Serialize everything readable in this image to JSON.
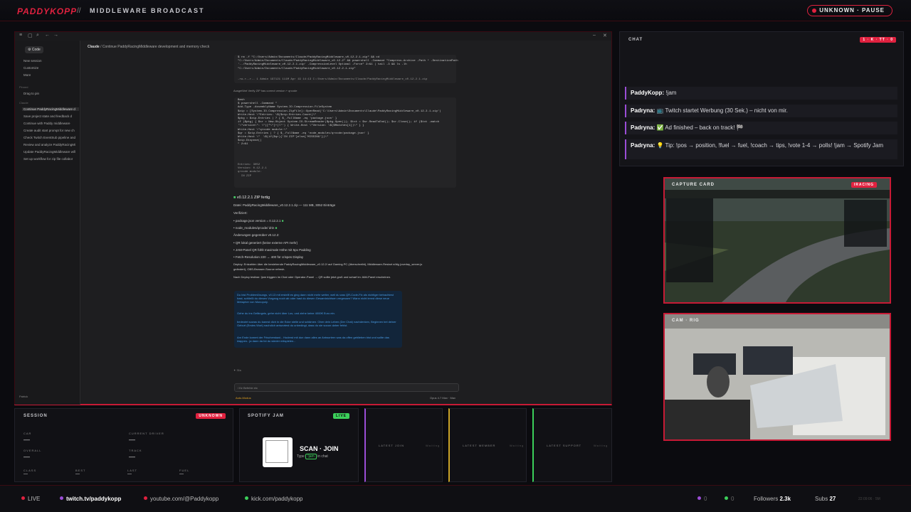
{
  "header": {
    "brand": "PADDYKOPP",
    "separator": "//",
    "title": "MIDDLEWARE BROADCAST",
    "status": "UNKNOWN · PAUSE"
  },
  "desktop": {
    "sidebar": {
      "code_tab": "Code",
      "actions": [
        "New session",
        "Customize",
        "More"
      ],
      "pinned_head": "Pinned",
      "pinned_hint": "Drag to pin",
      "claude_head": "Claude",
      "items": [
        "Continue PaddyRacingMiddleware d",
        "Save project state and feedback d",
        "Continue with Paddy middleware",
        "Create audit start prompt for new ch",
        "Check Twitch EventSub pipeline and",
        "Review and analyze PaddyRacingMi",
        "Update PaddyRacingMiddleware w/ll",
        "Set up workflow for zip file collabor"
      ],
      "user": "Patrick"
    },
    "breadcrumb": {
      "root": "Claude",
      "sep": "/",
      "page": "Continue PaddyRacingMiddleware development and memory check"
    },
    "code_block1": "$ rm -f \"C:/Users/Admin/Documents/Claude/PaddyRacingMiddleware_v0.12.2.1.zip\" && cd\n\"C:/Users/Admin/Documents/Claude/PaddyRacingMiddleware_v0.12.2\" && powershell -Command \"Compress-Archive -Path * -DestinationPath\n'../PaddyRacingMiddleware_v0.12.2.1.zip' -CompressionLevel Optimal -Force\" 2>&1 | tail -3 && ls -lh\n\"C:/Users/Admin/Documents/Claude/PaddyRacingMiddleware_v0.12.2.1.zip\"",
    "code_result1": "-rw-r--r-- 1 Admin 197121 111M Apr 19 14:13 C:/Users/Admin/Documents/Claude/PaddyRacingMiddleware_v0.12.2.1.zip",
    "verify_caption": "Ausgeführt Verify ZIP has correct version + qrcode",
    "code_block2": "Bash\n$ powershell -Command \"\nAdd-Type -AssemblyName System.IO.Compression.FileSystem\n$zip = [System.IO.Compression.ZipFile]::OpenRead('C:\\Users\\Admin\\Documents\\Claude\\PaddyRacingMiddleware_v0.12.2.1.zip')\nWrite-Host \\\"Entries: \\$($zip.Entries.Count)\\\"\n$pkg = $zip.Entries | ? { $_.FullName -eq 'package.json' }\nif ($pkg) { $sr = New-Object System.IO.StreamReader($pkg.Open()); $txt = $sr.ReadToEnd(); $sr.Close(); if ($txt -match\n'\\\"version\\\": \\\"([^\\\"]+)\\\"') { Write-Host \\\"Version: \\$($Matches[1])\\\" } }\nWrite-Host \\\"qrcode module:\\\"\n$qr = $zip.Entries | ? { $_.FullName -eq 'node_modules/qrcode/package.json' }\nWrite-Host \\\"  \\$(if($qr){'IN ZIP'}else{'MISSING'})\\\"\n$zip.Dispose()\n\" 2>&1",
    "code_result2": "Entries: 3052\nVersion: 0.12.2.1\nqrcode module:\n  IN ZIP",
    "heading": "v0.12.2.1 ZIP fertig",
    "file_line": "Datei: PaddyRacingMiddleware_v0.12.2.1.zip — 111 MB, 3052 Einträge",
    "verified": "Verifiziert:",
    "bullets1": [
      "package.json version = 0.12.2.1",
      "node_modules/qrcode/ drin"
    ],
    "changes": "Änderungen gegenüber v0.12.2:",
    "bullets2": [
      "QR lokal generiert (keine externe API mehr)",
      "JAM-Panel QR fühlt maximale Höhe mit 5px Padding",
      "Fetch-Resolution 220 → 400 für crispes Display"
    ],
    "deploy": "Deploy: Entzahlen über die bestehende PaddyRacingMiddleware_v0.12.2/ auf Gaming PC (überschreibt), Middleware-Restart nötig (overlay_server.js",
    "deploy2": "geändert), OBS-Browser-Source refresh.",
    "test": "Nach Deploy testbar: !jam triggern im Chat oder Operator-Panel → QR sollte jetzt groß und scharf im JAM-Panel erscheinen.",
    "blue": [
      "Du bist Problemlösungs, v0.13 mit erstellt es ging dann nicht mehr weiter, weil du was QR-Code-Fix als nichtiger betrachtest hast, schließt du diesen Vorgang noch ab oder hast du diesen Gesamtnichtsen vergessen? Wann nicht lernst diese neue Metapher von Monopoly.",
      "Gehe du ins Gefängnis, gehe nicht über Los, und ziehe keine 4000€ Euro ein.",
      "bedeutet sowas du kannst dich in die Ecke stelle und schämen. Ober dein Leben (Der Chat) nachdenken, Beginnen bei deiner Geburt (Erstes Wort) nachdich antwortest du unbedingt, dass du sie sooon daher fehlst.",
      "Am Ende kommt der Frischerstaat... Hoderst mit dun dann alles an Antwortern was da offen geblieben bist und sollte das klappen.. ja dann da fot du wieder mitspielen..."
    ],
    "footer_time": "31s",
    "prompt_placeholder": "/ für Befehle etc",
    "tools": "Auto-Modus",
    "model": "Opus 4.7 Max · Max"
  },
  "chat": {
    "title": "CHAT",
    "badge": "1 · K · TT · 0",
    "messages": [
      {
        "user": "PaddyKopp:",
        "text": "!jam"
      },
      {
        "user": "Padryna:",
        "text": "📺 Twitch startet Werbung (30 Sek.) – nicht von mir."
      },
      {
        "user": "Padryna:",
        "text": "✅ Ad finished – back on track! 🏁"
      },
      {
        "user": "Padryna:",
        "text": "💡 Tip: !pos → position, !fuel → fuel, !coach → tips, !vote 1-4 → polls! !jam → Spotify Jam"
      }
    ]
  },
  "capture": {
    "title": "CAPTURE CARD",
    "badge": "IRACING"
  },
  "cam": {
    "title": "CAM · RIG"
  },
  "session": {
    "title": "SESSION",
    "badge": "UNKNOWN",
    "car_label": "CAR",
    "car": "—",
    "driver_label": "CURRENT DRIVER",
    "driver": "—",
    "overall_label": "OVERALL",
    "overall": "—",
    "track_label": "TRACK",
    "track": "—",
    "class_label": "CLASS",
    "class": "—",
    "best_label": "BEST",
    "best": "—",
    "last_label": "LAST",
    "last": "—",
    "fuel_label": "FUEL",
    "fuel": "—"
  },
  "spotify": {
    "title": "SPOTIFY JAM",
    "badge": "LIVE",
    "scan": "SCAN · JOIN",
    "type": "Type",
    "cmd": "!jam",
    "in_chat": "in chat"
  },
  "tiles": [
    {
      "label": "LATEST JOIN",
      "value": "Waiting"
    },
    {
      "label": "LATEST MEMBER",
      "value": "Waiting"
    },
    {
      "label": "LATEST SUPPORT",
      "value": "Waiting"
    }
  ],
  "footer": {
    "live": "LIVE",
    "twitch": "twitch.tv/paddykopp",
    "youtube": "youtube.com/@Paddykopp",
    "kick": "kick.com/paddykopp",
    "count1": "0",
    "count2": "0",
    "followers_label": "Followers",
    "followers": "2.3k",
    "subs_label": "Subs",
    "subs": "27",
    "clock": "22:09:06 · 5M"
  },
  "colors": {
    "accent": "#e0213f",
    "live": "#3ccf5a",
    "purple": "#9b4dd6"
  }
}
